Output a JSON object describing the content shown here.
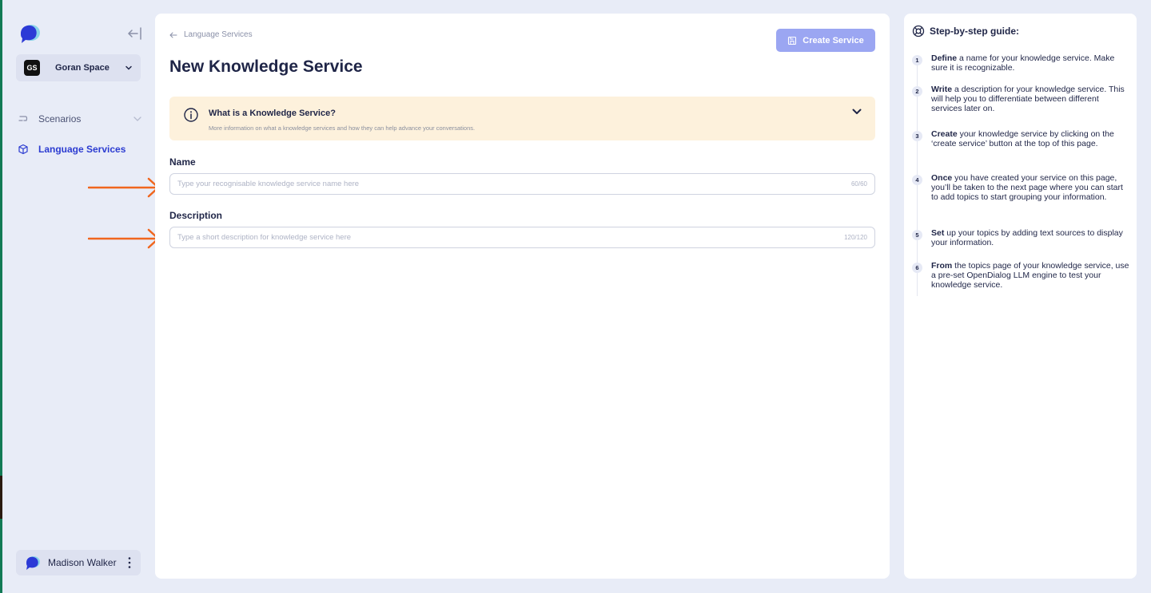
{
  "sidebar": {
    "workspace": {
      "badge": "GS",
      "name": "Goran Space"
    },
    "nav": [
      {
        "label": "Scenarios"
      },
      {
        "label": "Language Services"
      }
    ],
    "user": {
      "name": "Madison Walker"
    }
  },
  "main": {
    "breadcrumb": "Language Services",
    "title": "New Knowledge Service",
    "create_button": "Create Service",
    "info": {
      "title": "What is a Knowledge Service?",
      "subtitle": "More information on what a knowledge services and how they can help advance your conversations."
    },
    "name_field": {
      "label": "Name",
      "placeholder": "Type your recognisable knowledge service name here",
      "counter": "60/60"
    },
    "description_field": {
      "label": "Description",
      "placeholder": "Type a short description for knowledge service here",
      "counter": "120/120"
    }
  },
  "guide": {
    "title": "Step-by-step guide:",
    "steps": [
      {
        "num": "1",
        "bold": "Define",
        "text": " a name for your knowledge service. Make sure it is recognizable."
      },
      {
        "num": "2",
        "bold": "Write",
        "text": " a description for your knowledge service. This will help you to differentiate between different services later on."
      },
      {
        "num": "3",
        "bold": "Create",
        "text": " your knowledge service by clicking on the ‘create service’ button at the top of this page."
      },
      {
        "num": "4",
        "bold": "Once",
        "text": " you have created your service on this page, you’ll be taken to the next page where you can start to add topics to start grouping your information."
      },
      {
        "num": "5",
        "bold": "Set",
        "text": " up your topics by adding text sources to display your information."
      },
      {
        "num": "6",
        "bold": "From",
        "text": " the topics page of your knowledge service, use a pre-set OpenDialog LLM engine to test your knowledge service."
      }
    ]
  },
  "colors": {
    "accent": "#2b3bd1",
    "button": "#9ba6f2",
    "info_bg": "#fdf1dc",
    "annotation_arrow": "#f0661e",
    "background": "#e8ecf7"
  }
}
